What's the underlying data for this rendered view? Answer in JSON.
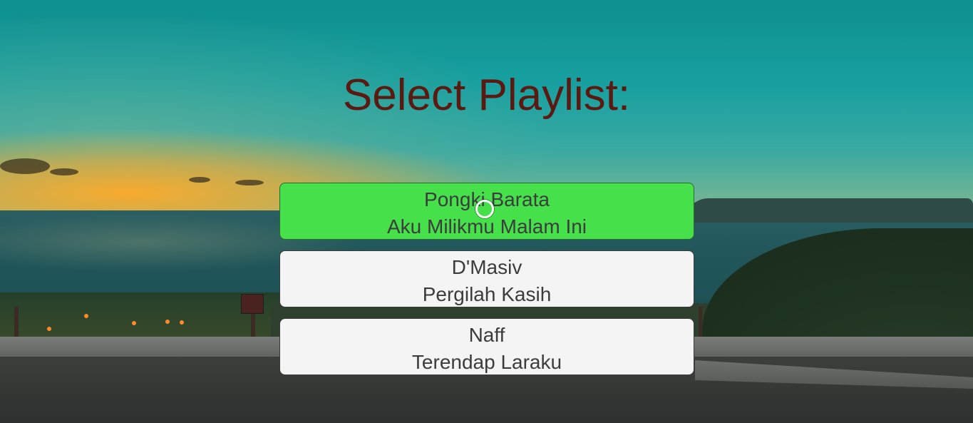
{
  "screen": {
    "title": "Select Playlist:"
  },
  "playlist": {
    "items": [
      {
        "artist": "Pongki Barata",
        "song": "Aku Milikmu Malam Ini",
        "state": "selected"
      },
      {
        "artist": "D'Masiv",
        "song": "Pergilah Kasih",
        "state": "normal"
      },
      {
        "artist": "Naff",
        "song": "Terendap Laraku",
        "state": "normal"
      }
    ]
  },
  "colors": {
    "title": "#5a1a12",
    "selected_button": "#45e04a",
    "button": "#f4f4f4",
    "button_text": "#3c3c3c"
  },
  "icons": {
    "gaze_cursor": "ring-cursor-icon"
  }
}
